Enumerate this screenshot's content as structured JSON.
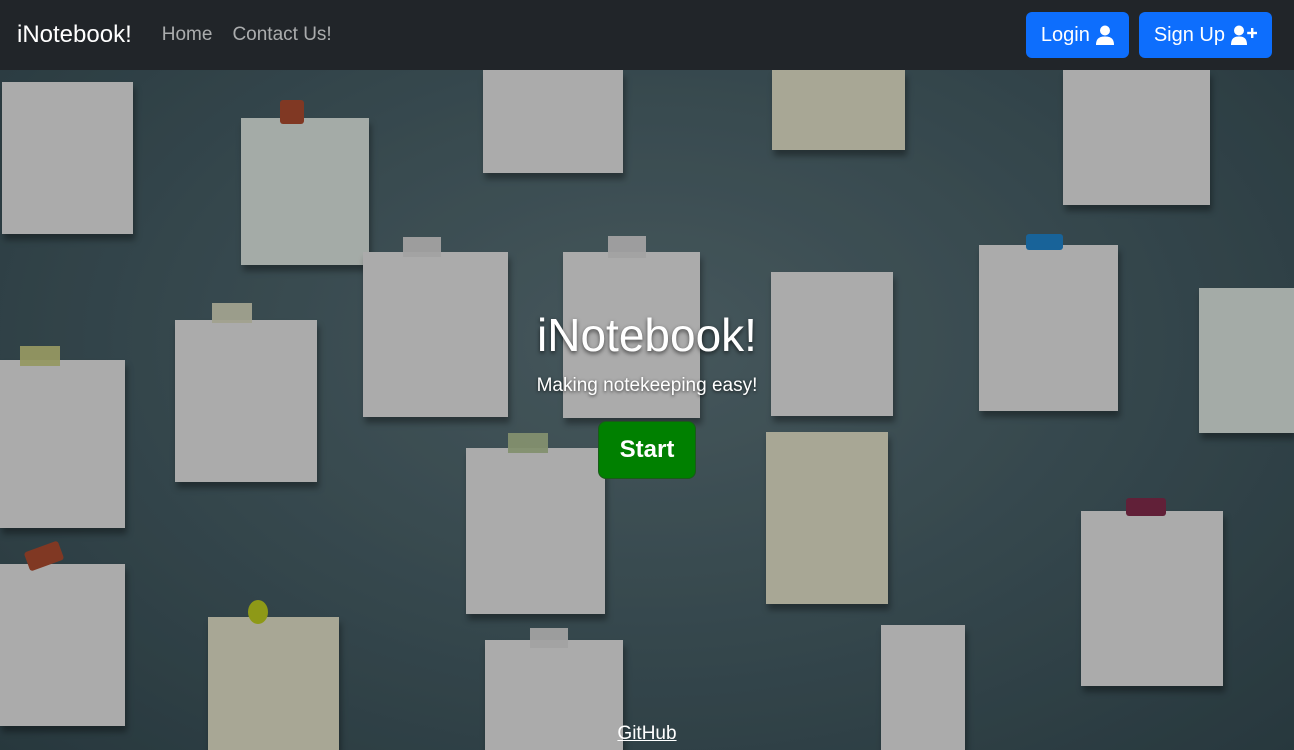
{
  "navbar": {
    "brand": "iNotebook!",
    "links": [
      "Home",
      "Contact Us!"
    ],
    "login_label": "Login",
    "signup_label": "Sign Up"
  },
  "hero": {
    "title": "iNotebook!",
    "subtitle": "Making notekeeping easy!",
    "start_label": "Start",
    "footer_link": "GitHub"
  },
  "colors": {
    "navbar_bg": "#212529",
    "primary_button": "#0d6efd",
    "start_button": "#008000"
  }
}
